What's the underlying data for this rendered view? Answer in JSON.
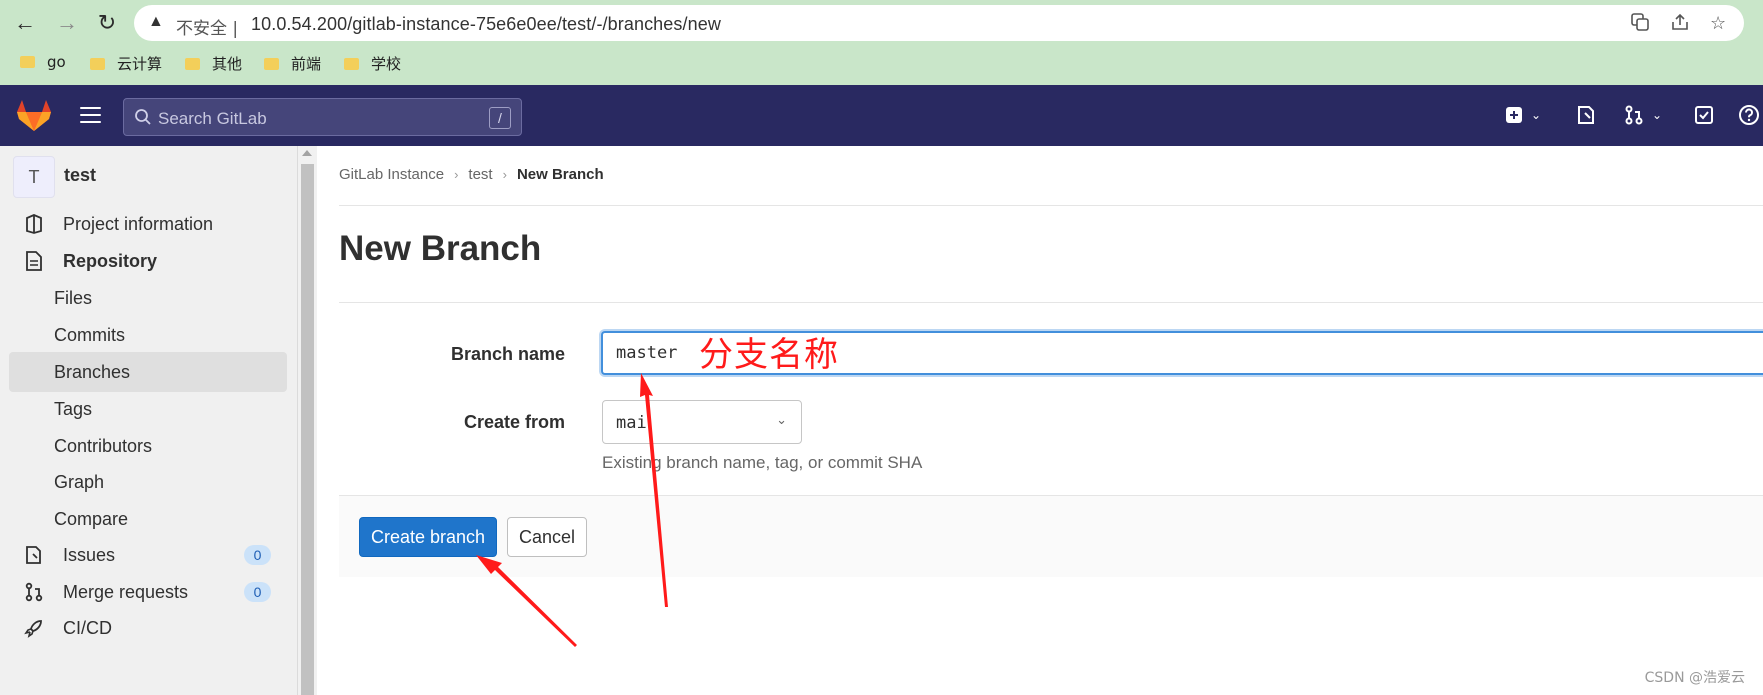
{
  "browser": {
    "insecure_label": "不安全 |",
    "url": "10.0.54.200/gitlab-instance-75e6e0ee/test/-/branches/new",
    "bookmarks": [
      "go",
      "云计算",
      "其他",
      "前端",
      "学校"
    ]
  },
  "header": {
    "search_placeholder": "Search GitLab",
    "search_shortcut": "/"
  },
  "sidebar": {
    "project_initial": "T",
    "project_name": "test",
    "items": [
      {
        "label": "Project information"
      },
      {
        "label": "Repository"
      },
      {
        "label": "Files"
      },
      {
        "label": "Commits"
      },
      {
        "label": "Branches"
      },
      {
        "label": "Tags"
      },
      {
        "label": "Contributors"
      },
      {
        "label": "Graph"
      },
      {
        "label": "Compare"
      },
      {
        "label": "Issues",
        "count": "0"
      },
      {
        "label": "Merge requests",
        "count": "0"
      },
      {
        "label": "CI/CD"
      }
    ]
  },
  "breadcrumb": {
    "items": [
      "GitLab Instance",
      "test"
    ],
    "current": "New Branch"
  },
  "page": {
    "title": "New Branch"
  },
  "form": {
    "branch_name_label": "Branch name",
    "branch_name_value": "master",
    "create_from_label": "Create from",
    "create_from_value": "mai",
    "help_text": "Existing branch name, tag, or commit SHA",
    "create_button": "Create branch",
    "cancel_button": "Cancel"
  },
  "annotation": {
    "text": "分支名称",
    "color": "#ff1a1a"
  },
  "watermark": "CSDN @浩爱云"
}
